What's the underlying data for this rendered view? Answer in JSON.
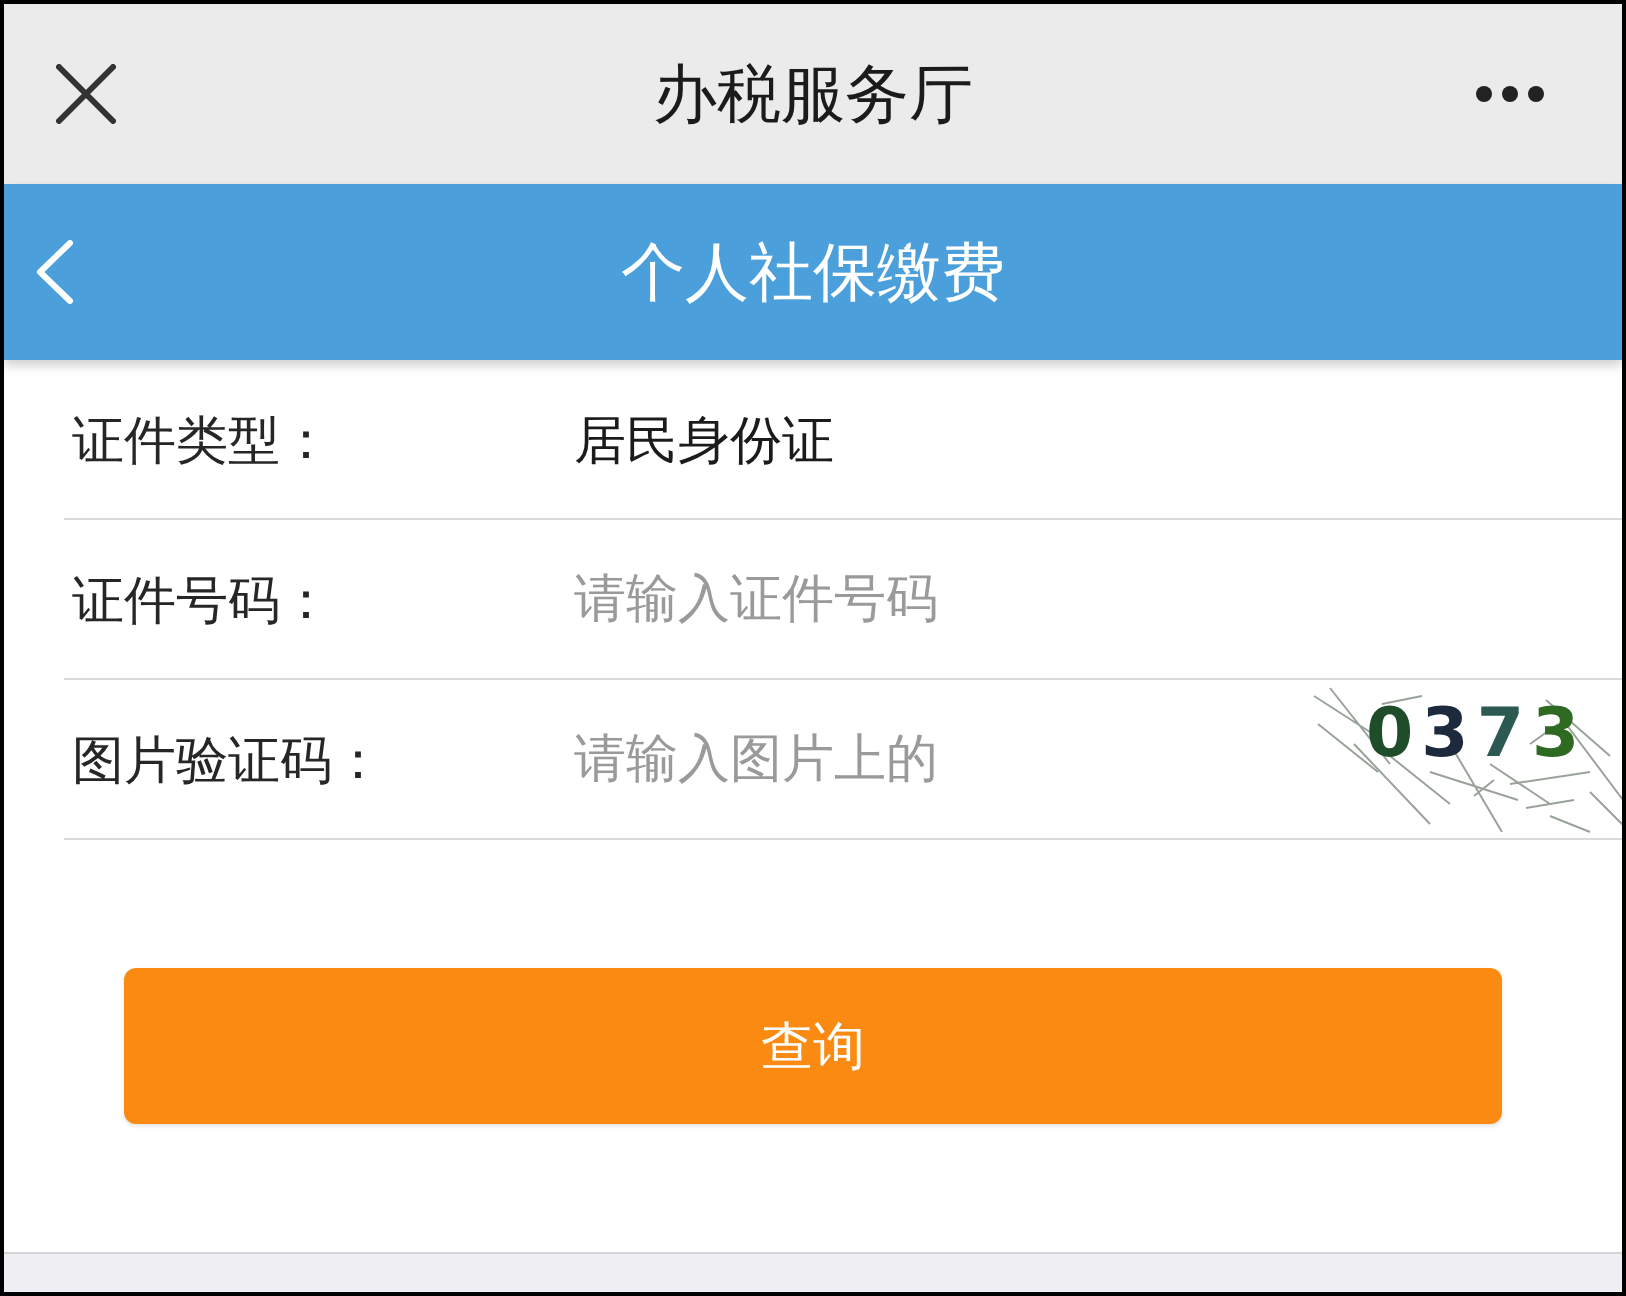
{
  "top_bar": {
    "title": "办税服务厅"
  },
  "header": {
    "title": "个人社保缴费"
  },
  "form": {
    "rows": [
      {
        "kind": "static",
        "label": "证件类型：",
        "value": "居民身份证"
      },
      {
        "kind": "input",
        "label": "证件号码：",
        "placeholder": "请输入证件号码"
      },
      {
        "kind": "captcha",
        "label": "图片验证码：",
        "placeholder": "请输入图片上的",
        "captcha_text": "0373"
      }
    ]
  },
  "submit_button": {
    "label": "查询"
  }
}
